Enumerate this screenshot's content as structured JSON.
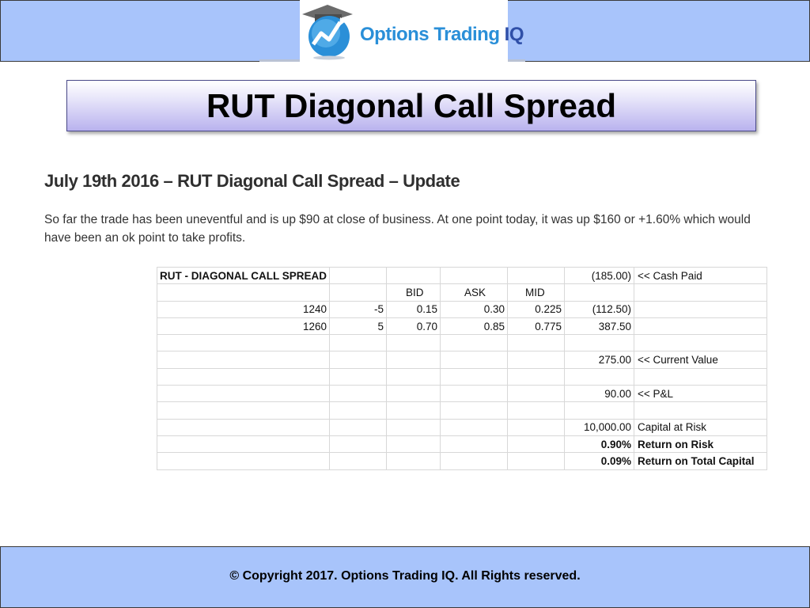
{
  "header": {
    "logo_text_main": "Options Trading",
    "logo_text_suffix": "IQ"
  },
  "slide": {
    "title": "RUT Diagonal Call Spread"
  },
  "post": {
    "heading": "July 19th 2016 – RUT Diagonal Call Spread – Update",
    "body": "So far the trade has been uneventful and is up $90 at close of business. At one point today, it was up $160 or +1.60% which would have been an ok point to take profits."
  },
  "sheet": {
    "rows": [
      [
        "RUT - DIAGONAL CALL SPREAD",
        "",
        "",
        "",
        "",
        "(185.00)",
        "<< Cash Paid"
      ],
      [
        "",
        "",
        "BID",
        "ASK",
        "MID",
        "",
        ""
      ],
      [
        "1240",
        "-5",
        "0.15",
        "0.30",
        "0.225",
        "(112.50)",
        ""
      ],
      [
        "1260",
        "5",
        "0.70",
        "0.85",
        "0.775",
        "387.50",
        ""
      ],
      [
        "",
        "",
        "",
        "",
        "",
        "",
        ""
      ],
      [
        "",
        "",
        "",
        "",
        "",
        "275.00",
        "<< Current Value"
      ],
      [
        "",
        "",
        "",
        "",
        "",
        "",
        ""
      ],
      [
        "",
        "",
        "",
        "",
        "",
        "90.00",
        "<< P&L"
      ],
      [
        "",
        "",
        "",
        "",
        "",
        "",
        ""
      ],
      [
        "",
        "",
        "",
        "",
        "",
        "10,000.00",
        "Capital at Risk"
      ],
      [
        "",
        "",
        "",
        "",
        "",
        "0.90%",
        "Return on Risk"
      ],
      [
        "",
        "",
        "",
        "",
        "",
        "0.09%",
        "Return on Total Capital"
      ]
    ]
  },
  "footer": {
    "copyright": "© Copyright 2017. Options Trading IQ. All Rights reserved."
  }
}
